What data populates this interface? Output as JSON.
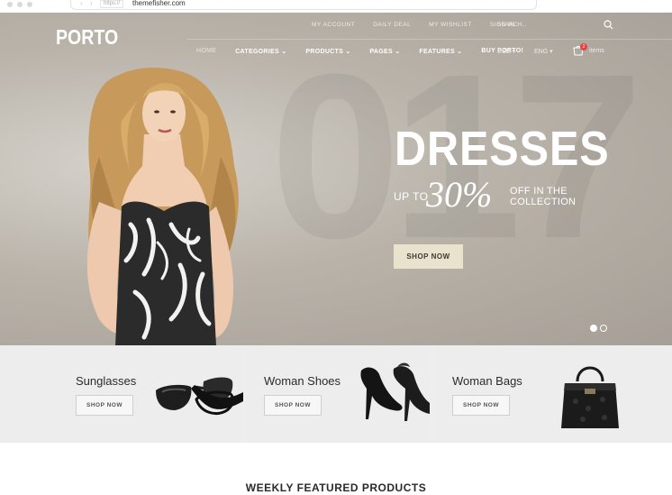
{
  "browser": {
    "nav_arrows": "‹ ›",
    "protocol": "https://",
    "domain": "themefisher.com"
  },
  "header": {
    "logo": "PORTO",
    "top_links": [
      "MY ACCOUNT",
      "DAILY DEAL",
      "MY WISHLIST",
      "SIGN IN"
    ],
    "search_placeholder": "SEARCH...",
    "nav": [
      "HOME",
      "CATEGORIES ⌄",
      "PRODUCTS ⌄",
      "PAGES ⌄",
      "FEATURES ⌄",
      "BUY PORTO!"
    ],
    "currency": "USD",
    "language": "ENG",
    "cart_count": "2",
    "cart_label": "items"
  },
  "hero": {
    "background_number": "017",
    "headline": "DRESSES",
    "up_to": "UP TO",
    "percent": "30%",
    "offer_line1": "OFF IN THE",
    "offer_line2": "COLLECTION",
    "button": "SHOP NOW",
    "slides": 2,
    "active_slide": 1
  },
  "categories": [
    {
      "title": "Sunglasses",
      "button": "SHOP NOW",
      "icon": "sunglasses-icon"
    },
    {
      "title": "Woman Shoes",
      "button": "SHOP NOW",
      "icon": "heels-icon"
    },
    {
      "title": "Woman Bags",
      "button": "SHOP NOW",
      "icon": "handbag-icon"
    }
  ],
  "section_title": "WEEKLY FEATURED PRODUCTS",
  "colors": {
    "hero_bg": "#b9b3aa",
    "button_bg": "#e9e2cd",
    "badge": "#e54343",
    "category_bg": "#ededed"
  }
}
